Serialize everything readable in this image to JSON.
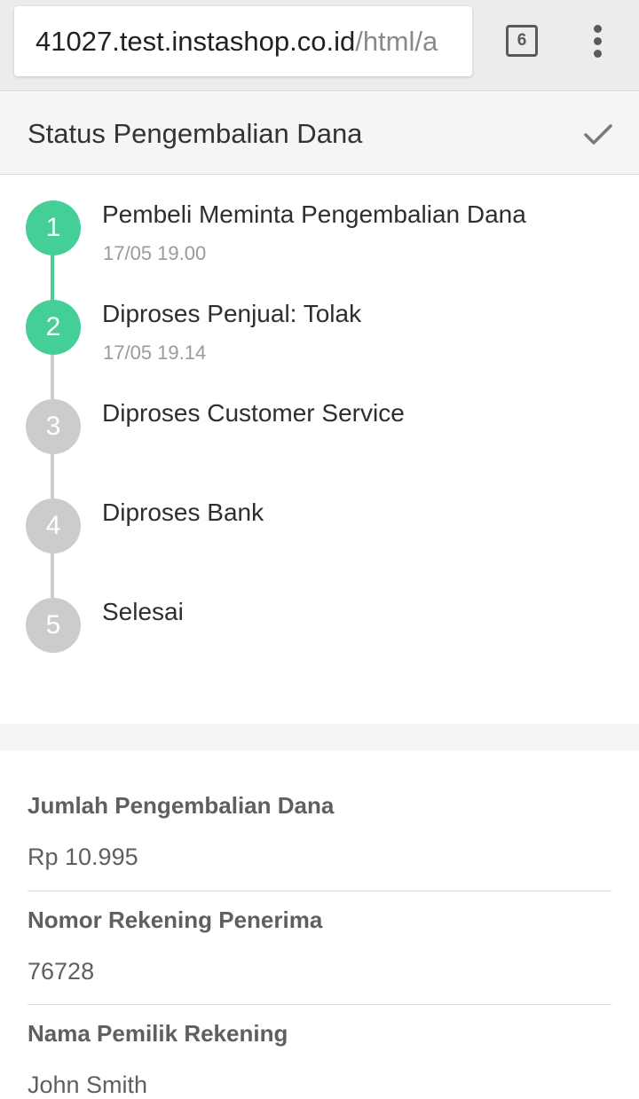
{
  "browser": {
    "url_host": "41027.test.instashop.co.id",
    "url_path": "/html/a",
    "tab_count": "6"
  },
  "header": {
    "title": "Status Pengembalian Dana"
  },
  "colors": {
    "done": "#44cf96",
    "pending": "#cccccc"
  },
  "steps": [
    {
      "number": "1",
      "title": "Pembeli Meminta Pengembalian Dana",
      "time": "17/05 19.00",
      "done": true
    },
    {
      "number": "2",
      "title": "Diproses Penjual: Tolak",
      "time": "17/05 19.14",
      "done": true
    },
    {
      "number": "3",
      "title": "Diproses Customer Service",
      "time": "",
      "done": false
    },
    {
      "number": "4",
      "title": "Diproses Bank",
      "time": "",
      "done": false
    },
    {
      "number": "5",
      "title": "Selesai",
      "time": "",
      "done": false
    }
  ],
  "details": {
    "amount_label": "Jumlah Pengembalian Dana",
    "amount_value": "Rp 10.995",
    "account_number_label": "Nomor Rekening Penerima",
    "account_number_value": "76728",
    "account_owner_label": "Nama Pemilik Rekening",
    "account_owner_value": "John Smith"
  }
}
